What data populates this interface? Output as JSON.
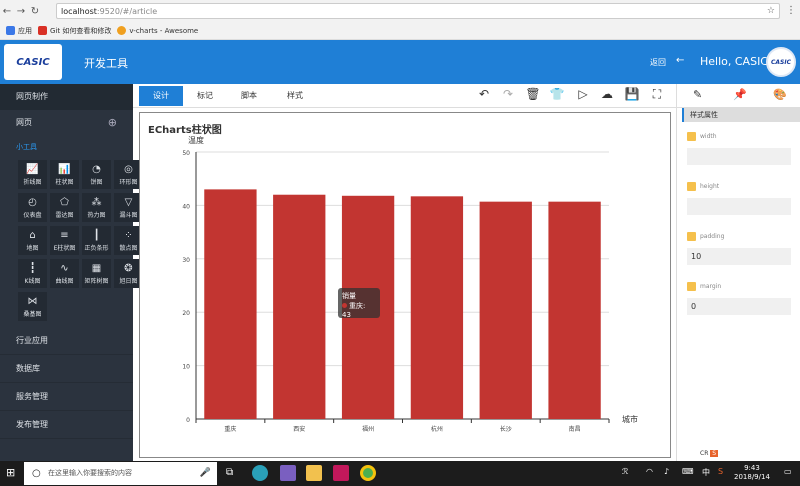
{
  "browser": {
    "url_host": "localhost",
    "url_path": ":9520/#/article",
    "bookmarks": [
      {
        "label": "应用",
        "color": "#3b78e7"
      },
      {
        "label": "Git 如何查看和修改",
        "color": "#d93025"
      },
      {
        "label": "v-charts - Awesome",
        "color": "#f0a020"
      }
    ]
  },
  "appbar": {
    "logo": "CASIC",
    "title": "开发工具",
    "back_label": "返回",
    "greeting": "Hello, CASIC"
  },
  "sidebar": {
    "web_make": "网页制作",
    "pages": "网页",
    "widgets_heading": "小工具",
    "tools": [
      {
        "icon": "line-chart-icon",
        "glyph": "📈",
        "label": "折线图"
      },
      {
        "icon": "bar-chart-icon",
        "glyph": "📊",
        "label": "柱状图"
      },
      {
        "icon": "pie-chart-icon",
        "glyph": "◔",
        "label": "饼图"
      },
      {
        "icon": "ring-chart-icon",
        "glyph": "◎",
        "label": "环形图"
      },
      {
        "icon": "gauge-icon",
        "glyph": "◴",
        "label": "仪表盘"
      },
      {
        "icon": "radar-icon",
        "glyph": "⬠",
        "label": "雷达图"
      },
      {
        "icon": "heatmap-icon",
        "glyph": "⁂",
        "label": "热力图"
      },
      {
        "icon": "funnel-icon",
        "glyph": "▽",
        "label": "漏斗图"
      },
      {
        "icon": "map-icon",
        "glyph": "⌂",
        "label": "地图"
      },
      {
        "icon": "hbar-chart-icon",
        "glyph": "≡",
        "label": "E柱状图"
      },
      {
        "icon": "pos-neg-bar-icon",
        "glyph": "┃",
        "label": "正负条形"
      },
      {
        "icon": "scatter-icon",
        "glyph": "⁘",
        "label": "散点图"
      },
      {
        "icon": "k-line-icon",
        "glyph": "┇",
        "label": "K线图"
      },
      {
        "icon": "curve-chart-icon",
        "glyph": "∿",
        "label": "曲线图"
      },
      {
        "icon": "treemap-icon",
        "glyph": "▦",
        "label": "矩阵树图"
      },
      {
        "icon": "sunburst-icon",
        "glyph": "❂",
        "label": "旭日图"
      },
      {
        "icon": "sankey-icon",
        "glyph": "⋈",
        "label": "桑基图"
      }
    ],
    "sections": [
      "行业应用",
      "数据库",
      "服务管理",
      "发布管理"
    ]
  },
  "toolbar": {
    "tabs": [
      "设计",
      "标记",
      "脚本",
      "样式"
    ],
    "active_tab": "设计"
  },
  "chart_data": {
    "type": "bar",
    "title": "ECharts柱状图",
    "ylabel": "温度",
    "xlabel": "城市",
    "categories": [
      "重庆",
      "西安",
      "福州",
      "杭州",
      "长沙",
      "南昌"
    ],
    "series": [
      {
        "name": "销量",
        "values": [
          43,
          42,
          41.8,
          41.7,
          40.7,
          40.7
        ]
      }
    ],
    "ylim": [
      0,
      50
    ],
    "yticks": [
      0,
      10,
      20,
      30,
      40,
      50
    ],
    "grid": true,
    "bar_color": "#c23531",
    "tooltip": {
      "title": "销量",
      "text": "重庆: 43"
    }
  },
  "props": {
    "header": "样式属性",
    "fields": [
      {
        "label": "width",
        "value": ""
      },
      {
        "label": "height",
        "value": ""
      },
      {
        "label": "padding",
        "value": "10"
      },
      {
        "label": "margin",
        "value": "0"
      }
    ]
  },
  "taskbar": {
    "search_placeholder": "在这里输入你要搜索的内容",
    "time": "9:43",
    "date": "2018/9/14",
    "ime": "中",
    "lang": "CR"
  }
}
